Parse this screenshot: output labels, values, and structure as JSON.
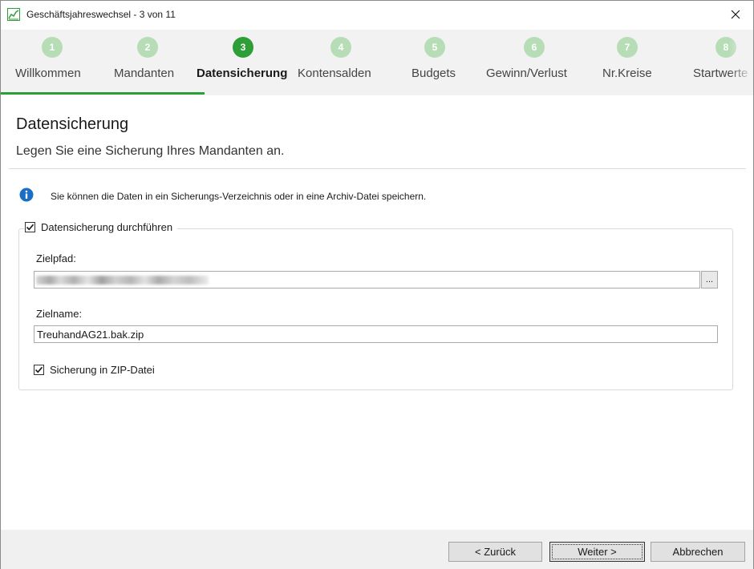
{
  "window": {
    "title": "Geschäftsjahreswechsel - 3 von 11"
  },
  "steps": [
    {
      "number": "1",
      "label": "Willkommen",
      "active": false
    },
    {
      "number": "2",
      "label": "Mandanten",
      "active": false
    },
    {
      "number": "3",
      "label": "Datensicherung",
      "active": true
    },
    {
      "number": "4",
      "label": "Kontensalden",
      "active": false
    },
    {
      "number": "5",
      "label": "Budgets",
      "active": false
    },
    {
      "number": "6",
      "label": "Gewinn/Verlust",
      "active": false
    },
    {
      "number": "7",
      "label": "Nr.Kreise",
      "active": false
    },
    {
      "number": "8",
      "label": "Startwerte",
      "active": false
    }
  ],
  "page": {
    "title": "Datensicherung",
    "subtitle": "Legen Sie eine Sicherung Ihres Mandanten an.",
    "info": "Sie können die Daten in ein Sicherungs-Verzeichnis oder in eine Archiv-Datei speichern."
  },
  "group": {
    "label": "Datensicherung durchführen",
    "checked": true
  },
  "zielpfad": {
    "label": "Zielpfad:",
    "value": "",
    "browse_label": "..."
  },
  "zielname": {
    "label": "Zielname:",
    "value": "TreuhandAG21.bak.zip"
  },
  "zip": {
    "label": "Sicherung in ZIP-Datei",
    "checked": true
  },
  "buttons": {
    "back": "< Zurück",
    "next": "Weiter >",
    "cancel": "Abbrechen"
  },
  "colors": {
    "accent": "#2e9e36",
    "step_inactive": "#b7ddb7",
    "info_blue": "#1a6fc4"
  },
  "icons": {
    "app": "chart-icon",
    "close": "close-icon",
    "info": "info-icon",
    "check": "check-icon"
  }
}
